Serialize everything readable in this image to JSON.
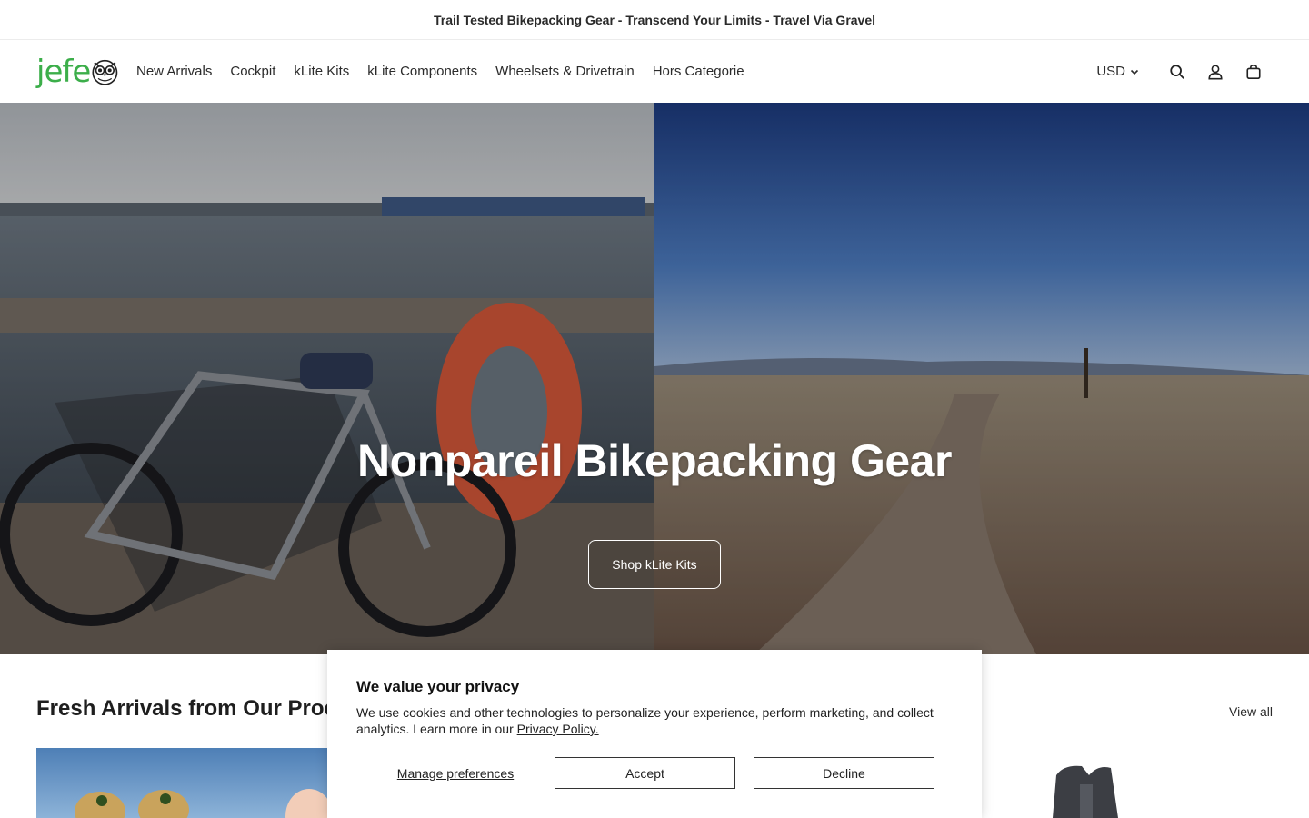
{
  "announcement": {
    "text": "Trail Tested Bikepacking Gear - Transcend Your Limits - Travel Via Gravel"
  },
  "header": {
    "logo_text": "jefe",
    "nav": [
      {
        "label": "New Arrivals"
      },
      {
        "label": "Cockpit"
      },
      {
        "label": "kLite Kits"
      },
      {
        "label": "kLite Components"
      },
      {
        "label": "Wheelsets & Drivetrain"
      },
      {
        "label": "Hors Categorie"
      }
    ],
    "currency": "USD",
    "icons": [
      "search-icon",
      "account-icon",
      "cart-icon"
    ]
  },
  "hero": {
    "title": "Nonpareil Bikepacking Gear",
    "button_label": "Shop kLite Kits"
  },
  "products_section": {
    "title": "Fresh Arrivals from Our Prod",
    "view_all_label": "View all"
  },
  "cookie_banner": {
    "title": "We value your privacy",
    "text": "We use cookies and other technologies to personalize your experience, perform marketing, and collect analytics. Learn more in our ",
    "privacy_link": "Privacy Policy.",
    "manage_label": "Manage preferences",
    "accept_label": "Accept",
    "decline_label": "Decline"
  },
  "colors": {
    "brand_green": "#3cae4a",
    "text_dark": "#1a1a1a"
  }
}
